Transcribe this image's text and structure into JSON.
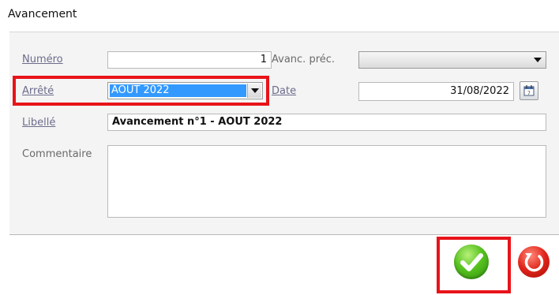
{
  "window": {
    "title": "Avancement"
  },
  "form": {
    "numero": {
      "label": "Numéro",
      "value": "1"
    },
    "avanc_prec": {
      "label": "Avanc. préc.",
      "value": ""
    },
    "arrete": {
      "label": "Arrêté",
      "value": "AOUT 2022"
    },
    "date": {
      "label": "Date",
      "value": "31/08/2022"
    },
    "libelle": {
      "label": "Libellé",
      "value": "Avancement n°1 - AOUT 2022"
    },
    "commentaire": {
      "label": "Commentaire",
      "value": ""
    }
  },
  "icons": {
    "calendar": "calendar-icon",
    "ok": "check-icon",
    "cancel": "cancel-icon"
  },
  "colors": {
    "highlight": "#e8131a",
    "selection": "#3399ff",
    "ok": "#57c21f",
    "cancel": "#e0241a"
  }
}
